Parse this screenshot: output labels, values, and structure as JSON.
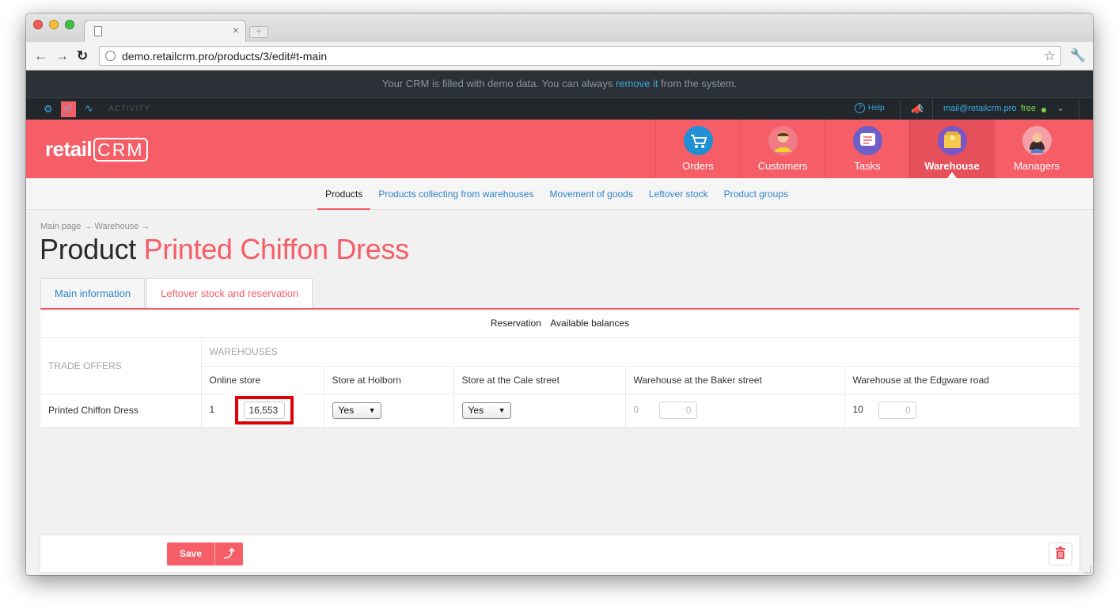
{
  "browser": {
    "url": "demo.retailcrm.pro/products/3/edit#t-main",
    "new_tab_label": "+",
    "close_tab_label": "×"
  },
  "banner": {
    "text_before": "Your CRM is filled with demo data. You can always",
    "link": "remove it",
    "text_after": "from the system."
  },
  "topstrip": {
    "activity": "ACTIVITY",
    "help": "Help",
    "email": "mail@retailcrm.pro",
    "plan": "free"
  },
  "header": {
    "logo_text": "retail",
    "logo_crm": "CRM",
    "modules": [
      {
        "label": "Orders",
        "icon": "cart-icon",
        "color": "#1f8fd6"
      },
      {
        "label": "Customers",
        "icon": "customer-icon",
        "color": "#f07a86"
      },
      {
        "label": "Tasks",
        "icon": "tasks-icon",
        "color": "#6c5fc7"
      },
      {
        "label": "Warehouse",
        "icon": "box-icon",
        "color": "#7a57c9",
        "active": true
      },
      {
        "label": "Managers",
        "icon": "manager-icon",
        "color": "#f4a0a8"
      }
    ]
  },
  "subnav": {
    "items": [
      "Products",
      "Products collecting from warehouses",
      "Movement of goods",
      "Leftover stock",
      "Product groups"
    ],
    "active": "Products"
  },
  "breadcrumb": "Main page → Warehouse →",
  "title": {
    "prefix": "Product",
    "name": "Printed Chiffon Dress"
  },
  "tabs": [
    "Main information",
    "Leftover stock and reservation"
  ],
  "panel": {
    "toggle": [
      "Reservation",
      "Available balances"
    ],
    "trade_offers_header": "TRADE OFFERS",
    "warehouses_header": "WAREHOUSES",
    "columns": [
      "Online store",
      "Store at Holborn",
      "Store at the Cale street",
      "Warehouse at the Baker street",
      "Warehouse at the Edgware road"
    ],
    "row": {
      "offer": "Printed Chiffon Dress",
      "online_store_qty": "1",
      "online_store_value": "16,553",
      "holborn_select": "Yes",
      "cale_select": "Yes",
      "baker_qty": "0",
      "baker_value": "0",
      "edgware_qty": "10",
      "edgware_value": "0"
    }
  },
  "footer": {
    "save_label": "Save"
  },
  "colors": {
    "brand": "#f55d67",
    "link": "#2e84c6",
    "dark_bar": "#2c3138",
    "highlight_box": "#e0000a"
  }
}
